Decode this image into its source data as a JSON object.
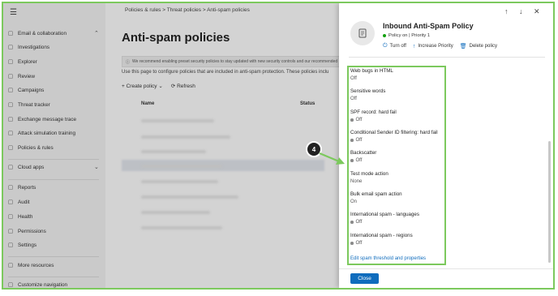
{
  "breadcrumb": {
    "part1": "Policies & rules",
    "sep1": ">",
    "part2": "Threat policies",
    "sep2": ">",
    "part3": "Anti-spam policies"
  },
  "page": {
    "title": "Anti-spam policies",
    "info": "We recommend enabling preset security policies to stay updated with new security controls and our recommended",
    "description": "Use this page to configure policies that are included in anti-spam protection. These policies inclu",
    "create_label": "Create policy",
    "refresh_label": "Refresh",
    "col_name": "Name",
    "col_status": "Status"
  },
  "sidebar": {
    "items": [
      {
        "label": "Email & collaboration",
        "icon": "mail-icon"
      },
      {
        "label": "Investigations",
        "icon": "investigation-icon"
      },
      {
        "label": "Explorer",
        "icon": "explorer-icon"
      },
      {
        "label": "Review",
        "icon": "review-icon"
      },
      {
        "label": "Campaigns",
        "icon": "campaigns-icon"
      },
      {
        "label": "Threat tracker",
        "icon": "threat-tracker-icon"
      },
      {
        "label": "Exchange message trace",
        "icon": "exchange-icon"
      },
      {
        "label": "Attack simulation training",
        "icon": "attack-sim-icon"
      },
      {
        "label": "Policies & rules",
        "icon": "policies-icon"
      },
      {
        "label": "Cloud apps",
        "icon": "cloud-icon"
      },
      {
        "label": "Reports",
        "icon": "reports-icon"
      },
      {
        "label": "Audit",
        "icon": "audit-icon"
      },
      {
        "label": "Health",
        "icon": "health-icon"
      },
      {
        "label": "Permissions",
        "icon": "permissions-icon"
      },
      {
        "label": "Settings",
        "icon": "settings-icon"
      },
      {
        "label": "More resources",
        "icon": "more-resources-icon"
      },
      {
        "label": "Customize navigation",
        "icon": "edit-icon"
      }
    ]
  },
  "panel": {
    "title": "Inbound Anti-Spam Policy",
    "status": "Policy on | Priority 1",
    "turn_off_label": "Turn off",
    "increase_priority_label": "Increase Priority",
    "delete_label": "Delete policy",
    "fields": [
      {
        "label": "Web bugs in HTML",
        "value": "Off",
        "dot": false
      },
      {
        "label": "Sensitive words",
        "value": "Off",
        "dot": false
      },
      {
        "label": "SPF record: hard fail",
        "value": "Off",
        "dot": true
      },
      {
        "label": "Conditional Sender ID filtering: hard fail",
        "value": "Off",
        "dot": true
      },
      {
        "label": "Backscatter",
        "value": "Off",
        "dot": true
      },
      {
        "label": "Test mode action",
        "value": "None",
        "dot": false
      },
      {
        "label": "Bulk email spam action",
        "value": "On",
        "dot": false
      },
      {
        "label": "International spam - languages",
        "value": "Off",
        "dot": true
      },
      {
        "label": "International spam - regions",
        "value": "Off",
        "dot": true
      }
    ],
    "edit_link": "Edit spam threshold and properties",
    "close_label": "Close"
  },
  "callout": {
    "number": "4"
  },
  "colors": {
    "accent": "#0f6cbd",
    "highlight": "#7cc95d",
    "status_on": "#13a10e"
  }
}
